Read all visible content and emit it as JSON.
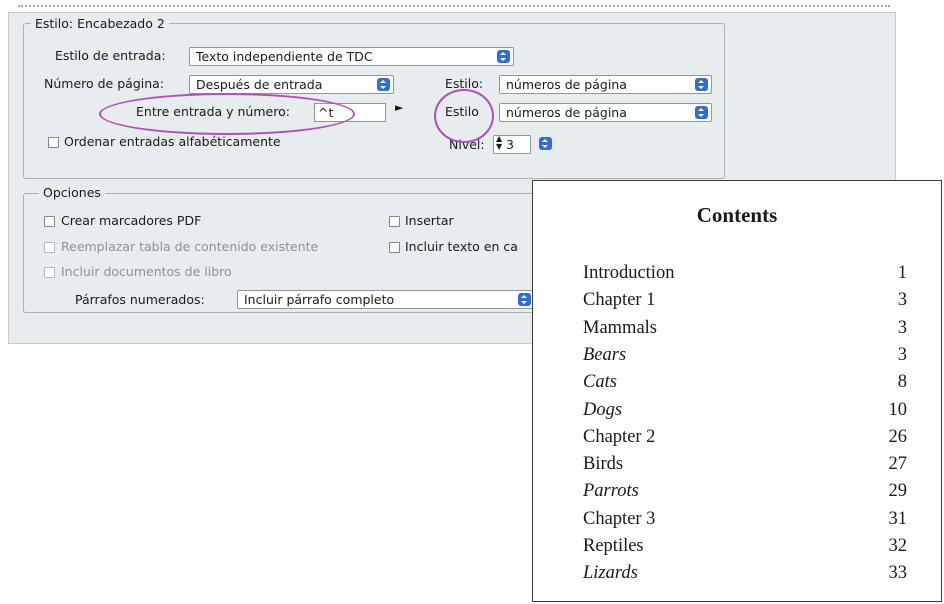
{
  "dialog": {
    "style_group": {
      "title": "Estilo: Encabezado 2",
      "entry_style_label": "Estilo de entrada:",
      "entry_style_value": "Texto independiente de TDC",
      "page_number_label": "Número de página:",
      "page_number_value": "Después de entrada",
      "style1_label": "Estilo:",
      "style1_value": "números de página",
      "between_label": "Entre entrada y número:",
      "between_value": "^t",
      "style2_label": "Estilo",
      "style2_value": "números de página",
      "sort_label": "Ordenar entradas alfabéticamente",
      "level_label": "Nivel:",
      "level_value": "3"
    },
    "options_group": {
      "title": "Opciones",
      "create_pdf": "Crear marcadores PDF",
      "replace_toc": "Reemplazar tabla de contenido existente",
      "include_book": "Incluir documentos de libro",
      "insert": "Insertar",
      "include_text": "Incluir texto en ca",
      "numbered_label": "Párrafos numerados:",
      "numbered_value": "Incluir párrafo completo"
    },
    "accent_color": "#b050b8"
  },
  "toc": {
    "title": "Contents",
    "entries": [
      {
        "text": "Introduction",
        "page": "1",
        "italic": false
      },
      {
        "text": "Chapter 1",
        "page": "3",
        "italic": false
      },
      {
        "text": "Mammals",
        "page": "3",
        "italic": false
      },
      {
        "text": "Bears",
        "page": "3",
        "italic": true
      },
      {
        "text": "Cats",
        "page": "8",
        "italic": true
      },
      {
        "text": "Dogs",
        "page": "10",
        "italic": true
      },
      {
        "text": "Chapter 2",
        "page": "26",
        "italic": false
      },
      {
        "text": "Birds",
        "page": "27",
        "italic": false
      },
      {
        "text": "Parrots",
        "page": "29",
        "italic": true
      },
      {
        "text": "Chapter 3",
        "page": "31",
        "italic": false
      },
      {
        "text": "Reptiles",
        "page": "32",
        "italic": false
      },
      {
        "text": "Lizards",
        "page": "33",
        "italic": true
      }
    ]
  }
}
